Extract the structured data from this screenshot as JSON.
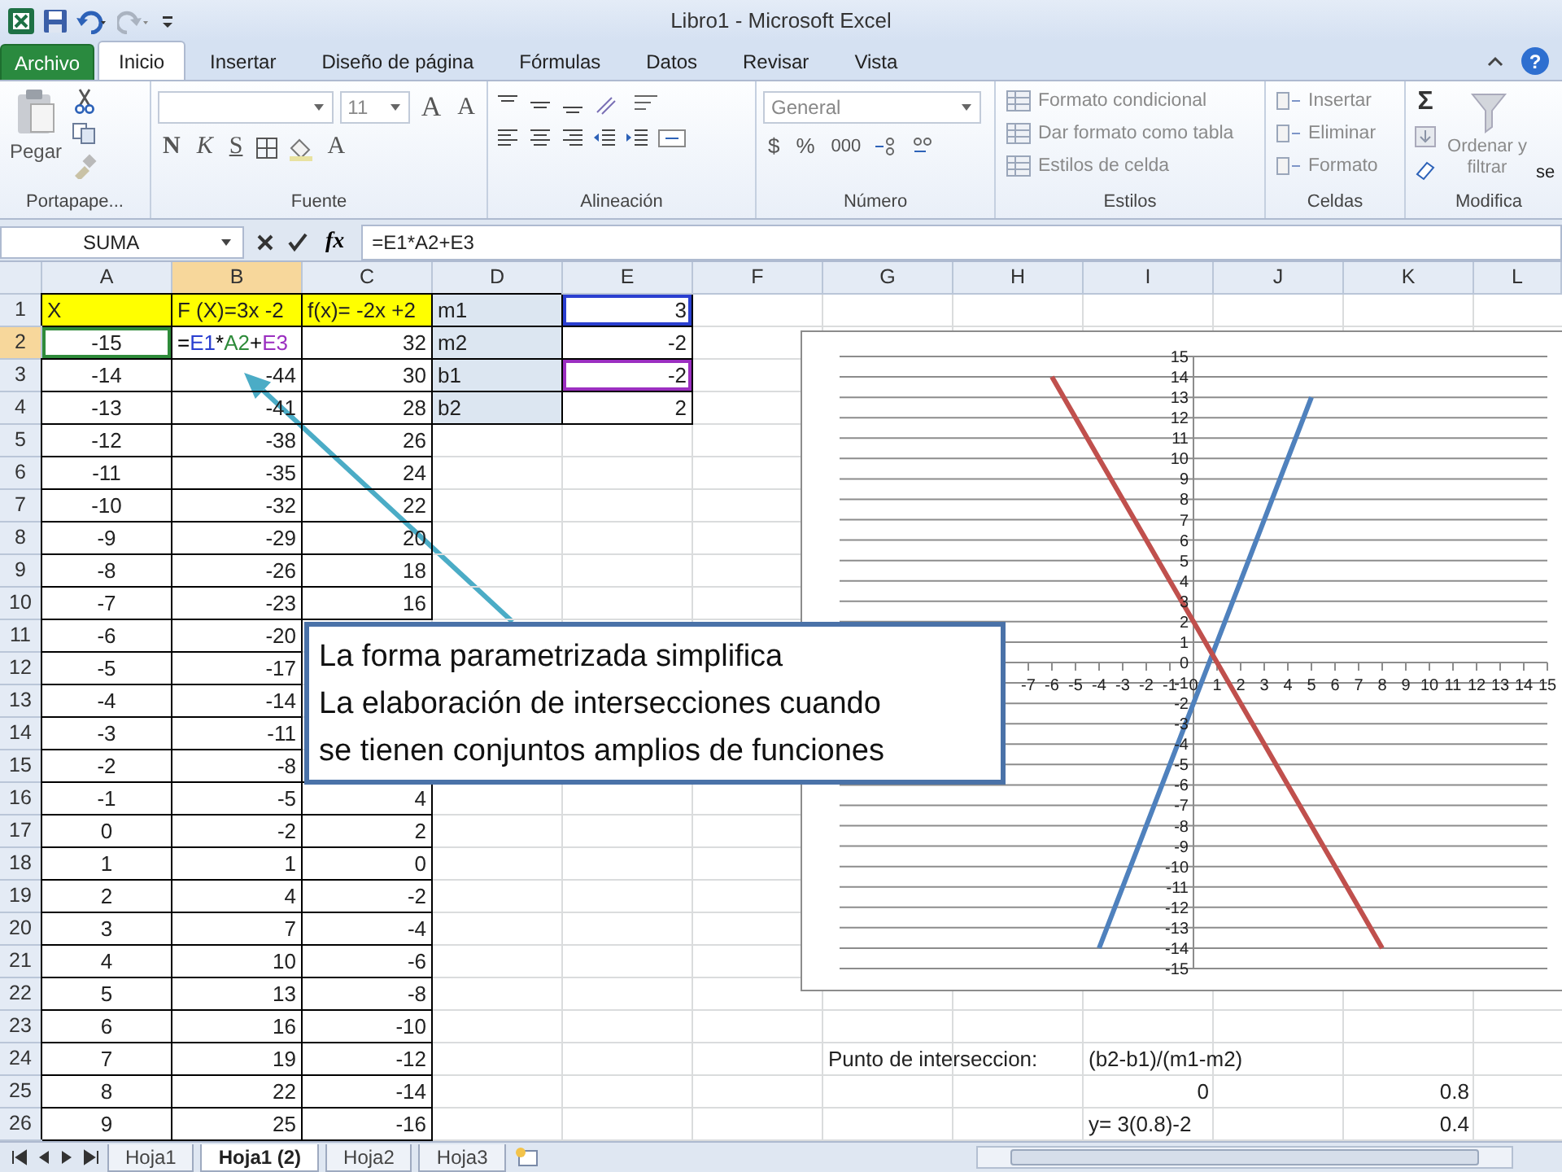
{
  "window": {
    "title": "Libro1  -  Microsoft Excel"
  },
  "ribbon_tabs": [
    {
      "label": "Archivo",
      "kind": "file",
      "selected": false
    },
    {
      "label": "Inicio",
      "kind": "tab",
      "selected": true
    },
    {
      "label": "Insertar",
      "kind": "tab",
      "selected": false
    },
    {
      "label": "Diseño de página",
      "kind": "tab",
      "selected": false
    },
    {
      "label": "Fórmulas",
      "kind": "tab",
      "selected": false
    },
    {
      "label": "Datos",
      "kind": "tab",
      "selected": false
    },
    {
      "label": "Revisar",
      "kind": "tab",
      "selected": false
    },
    {
      "label": "Vista",
      "kind": "tab",
      "selected": false
    }
  ],
  "help": {
    "label": "?"
  },
  "ribbon": {
    "clipboard": {
      "paste": "Pegar",
      "label": "Portapape..."
    },
    "font": {
      "font_size": "11",
      "grow": "A",
      "shrink": "A",
      "bold": "N",
      "italic": "K",
      "underline": "S",
      "font_color": "A",
      "label": "Fuente"
    },
    "alignment": {
      "label": "Alineación"
    },
    "number": {
      "format": "General",
      "currency": "$",
      "percent": "%",
      "thousands": "000",
      "label": "Número"
    },
    "styles": {
      "items": [
        {
          "label": "Formato condicional",
          "disabled": true
        },
        {
          "label": "Dar formato como tabla",
          "disabled": true
        },
        {
          "label": "Estilos de celda",
          "disabled": true
        }
      ],
      "label": "Estilos"
    },
    "cells": {
      "items": [
        {
          "label": "Insertar",
          "disabled": true
        },
        {
          "label": "Eliminar",
          "disabled": true
        },
        {
          "label": "Formato",
          "disabled": true
        }
      ],
      "label": "Celdas"
    },
    "editing": {
      "sum": "Σ",
      "sort": "Ordenar y filtrar",
      "cut_text": "se",
      "label": "Modifica"
    }
  },
  "formula_bar": {
    "name_box": "SUMA",
    "fx": "fx",
    "formula": "=E1*A2+E3"
  },
  "sheet": {
    "columns": [
      {
        "label": "A",
        "selected": false
      },
      {
        "label": "B",
        "selected": true
      },
      {
        "label": "C",
        "selected": false
      },
      {
        "label": "D",
        "selected": false
      },
      {
        "label": "E",
        "selected": false
      },
      {
        "label": "F",
        "selected": false
      },
      {
        "label": "G",
        "selected": false
      },
      {
        "label": "H",
        "selected": false
      },
      {
        "label": "I",
        "selected": false
      },
      {
        "label": "J",
        "selected": false
      },
      {
        "label": "K",
        "selected": false
      },
      {
        "label": "L",
        "selected": false
      }
    ],
    "rows": [
      {
        "number": "1",
        "selected": false,
        "cells": [
          {
            "value": "X",
            "kind": "header",
            "bordered": true
          },
          {
            "value": "F (X)=3x -2",
            "kind": "header",
            "bordered": true
          },
          {
            "value": "f(x)= -2x +2",
            "kind": "header",
            "bordered": true
          },
          {
            "value": "m1",
            "kind": "param",
            "bordered": true
          },
          {
            "value": "3",
            "kind": "number",
            "bordered": true,
            "color": "#2a3fd0"
          }
        ]
      },
      {
        "number": "2",
        "selected": true,
        "cells": [
          {
            "value": "-15",
            "kind": "centered",
            "bordered": true,
            "color": "#2e8b3a"
          },
          {
            "kind": "formula",
            "bordered": true,
            "tokens": [
              {
                "text": "=",
                "color": "#000000"
              },
              {
                "text": "E1",
                "color": "#2a3fd0"
              },
              {
                "text": "*",
                "color": "#000000"
              },
              {
                "text": "A2",
                "color": "#2e8b3a"
              },
              {
                "text": "+",
                "color": "#000000"
              },
              {
                "text": "E3",
                "color": "#9b2fc0"
              }
            ]
          },
          {
            "value": "32",
            "kind": "number",
            "bordered": true
          },
          {
            "value": "m2",
            "kind": "param",
            "bordered": true
          },
          {
            "value": "-2",
            "kind": "number",
            "bordered": true
          }
        ]
      },
      {
        "number": "3",
        "selected": false,
        "cells": [
          {
            "value": "-14",
            "kind": "centered",
            "bordered": true
          },
          {
            "value": "-44",
            "kind": "number",
            "bordered": true
          },
          {
            "value": "30",
            "kind": "number",
            "bordered": true
          },
          {
            "value": "b1",
            "kind": "param",
            "bordered": true
          },
          {
            "value": "-2",
            "kind": "number",
            "bordered": true,
            "color": "#9b2fc0"
          }
        ]
      },
      {
        "number": "4",
        "selected": false,
        "cells": [
          {
            "value": "-13",
            "kind": "centered",
            "bordered": true
          },
          {
            "value": "-41",
            "kind": "number",
            "bordered": true
          },
          {
            "value": "28",
            "kind": "number",
            "bordered": true
          },
          {
            "value": "b2",
            "kind": "param",
            "bordered": true
          },
          {
            "value": "2",
            "kind": "number",
            "bordered": true
          }
        ]
      },
      {
        "number": "5",
        "selected": false,
        "cells": [
          {
            "value": "-12",
            "kind": "centered",
            "bordered": true
          },
          {
            "value": "-38",
            "kind": "number",
            "bordered": true
          },
          {
            "value": "26",
            "kind": "number",
            "bordered": true
          }
        ]
      },
      {
        "number": "6",
        "selected": false,
        "cells": [
          {
            "value": "-11",
            "kind": "centered",
            "bordered": true
          },
          {
            "value": "-35",
            "kind": "number",
            "bordered": true
          },
          {
            "value": "24",
            "kind": "number",
            "bordered": true
          }
        ]
      },
      {
        "number": "7",
        "selected": false,
        "cells": [
          {
            "value": "-10",
            "kind": "centered",
            "bordered": true
          },
          {
            "value": "-32",
            "kind": "number",
            "bordered": true
          },
          {
            "value": "22",
            "kind": "number",
            "bordered": true
          }
        ]
      },
      {
        "number": "8",
        "selected": false,
        "cells": [
          {
            "value": "-9",
            "kind": "centered",
            "bordered": true
          },
          {
            "value": "-29",
            "kind": "number",
            "bordered": true
          },
          {
            "value": "20",
            "kind": "number",
            "bordered": true
          }
        ]
      },
      {
        "number": "9",
        "selected": false,
        "cells": [
          {
            "value": "-8",
            "kind": "centered",
            "bordered": true
          },
          {
            "value": "-26",
            "kind": "number",
            "bordered": true
          },
          {
            "value": "18",
            "kind": "number",
            "bordered": true
          }
        ]
      },
      {
        "number": "10",
        "selected": false,
        "cells": [
          {
            "value": "-7",
            "kind": "centered",
            "bordered": true
          },
          {
            "value": "-23",
            "kind": "number",
            "bordered": true
          },
          {
            "value": "16",
            "kind": "number",
            "bordered": true
          }
        ]
      },
      {
        "number": "11",
        "selected": false,
        "cells": [
          {
            "value": "-6",
            "kind": "centered",
            "bordered": true
          },
          {
            "value": "-20",
            "kind": "number",
            "bordered": true
          }
        ]
      },
      {
        "number": "12",
        "selected": false,
        "cells": [
          {
            "value": "-5",
            "kind": "centered",
            "bordered": true
          },
          {
            "value": "-17",
            "kind": "number",
            "bordered": true
          }
        ]
      },
      {
        "number": "13",
        "selected": false,
        "cells": [
          {
            "value": "-4",
            "kind": "centered",
            "bordered": true
          },
          {
            "value": "-14",
            "kind": "number",
            "bordered": true
          }
        ]
      },
      {
        "number": "14",
        "selected": false,
        "cells": [
          {
            "value": "-3",
            "kind": "centered",
            "bordered": true
          },
          {
            "value": "-11",
            "kind": "number",
            "bordered": true
          }
        ]
      },
      {
        "number": "15",
        "selected": false,
        "cells": [
          {
            "value": "-2",
            "kind": "centered",
            "bordered": true
          },
          {
            "value": "-8",
            "kind": "number",
            "bordered": true
          }
        ]
      },
      {
        "number": "16",
        "selected": false,
        "cells": [
          {
            "value": "-1",
            "kind": "centered",
            "bordered": true
          },
          {
            "value": "-5",
            "kind": "number",
            "bordered": true
          },
          {
            "value": "4",
            "kind": "number",
            "bordered": true
          }
        ]
      },
      {
        "number": "17",
        "selected": false,
        "cells": [
          {
            "value": "0",
            "kind": "centered",
            "bordered": true
          },
          {
            "value": "-2",
            "kind": "number",
            "bordered": true
          },
          {
            "value": "2",
            "kind": "number",
            "bordered": true
          }
        ]
      },
      {
        "number": "18",
        "selected": false,
        "cells": [
          {
            "value": "1",
            "kind": "centered",
            "bordered": true
          },
          {
            "value": "1",
            "kind": "number",
            "bordered": true
          },
          {
            "value": "0",
            "kind": "number",
            "bordered": true
          }
        ]
      },
      {
        "number": "19",
        "selected": false,
        "cells": [
          {
            "value": "2",
            "kind": "centered",
            "bordered": true
          },
          {
            "value": "4",
            "kind": "number",
            "bordered": true
          },
          {
            "value": "-2",
            "kind": "number",
            "bordered": true
          }
        ]
      },
      {
        "number": "20",
        "selected": false,
        "cells": [
          {
            "value": "3",
            "kind": "centered",
            "bordered": true
          },
          {
            "value": "7",
            "kind": "number",
            "bordered": true
          },
          {
            "value": "-4",
            "kind": "number",
            "bordered": true
          }
        ]
      },
      {
        "number": "21",
        "selected": false,
        "cells": [
          {
            "value": "4",
            "kind": "centered",
            "bordered": true
          },
          {
            "value": "10",
            "kind": "number",
            "bordered": true
          },
          {
            "value": "-6",
            "kind": "number",
            "bordered": true
          }
        ]
      },
      {
        "number": "22",
        "selected": false,
        "cells": [
          {
            "value": "5",
            "kind": "centered",
            "bordered": true
          },
          {
            "value": "13",
            "kind": "number",
            "bordered": true
          },
          {
            "value": "-8",
            "kind": "number",
            "bordered": true
          }
        ]
      },
      {
        "number": "23",
        "selected": false,
        "cells": [
          {
            "value": "6",
            "kind": "centered",
            "bordered": true
          },
          {
            "value": "16",
            "kind": "number",
            "bordered": true
          },
          {
            "value": "-10",
            "kind": "number",
            "bordered": true
          }
        ]
      },
      {
        "number": "24",
        "selected": false,
        "cells": [
          {
            "value": "7",
            "kind": "centered",
            "bordered": true
          },
          {
            "value": "19",
            "kind": "number",
            "bordered": true
          },
          {
            "value": "-12",
            "kind": "number",
            "bordered": true
          },
          null,
          null,
          null,
          {
            "value": "Punto de interseccion:",
            "kind": "text"
          },
          null,
          {
            "value": "(b2-b1)/(m1-m2)",
            "kind": "text"
          }
        ]
      },
      {
        "number": "25",
        "selected": false,
        "cells": [
          {
            "value": "8",
            "kind": "centered",
            "bordered": true
          },
          {
            "value": "22",
            "kind": "number",
            "bordered": true
          },
          {
            "value": "-14",
            "kind": "number",
            "bordered": true
          },
          null,
          null,
          null,
          null,
          null,
          {
            "value": "0",
            "kind": "number"
          },
          null,
          {
            "value": "0.8",
            "kind": "number"
          }
        ]
      },
      {
        "number": "26",
        "selected": false,
        "cells": [
          {
            "value": "9",
            "kind": "centered",
            "bordered": true
          },
          {
            "value": "25",
            "kind": "number",
            "bordered": true
          },
          {
            "value": "-16",
            "kind": "number",
            "bordered": true
          },
          null,
          null,
          null,
          null,
          null,
          {
            "value": "y= 3(0.8)-2",
            "kind": "text"
          },
          null,
          {
            "value": "0.4",
            "kind": "number"
          }
        ]
      }
    ],
    "chart": {
      "chart_data": {
        "type": "line",
        "x": [
          -6,
          -5,
          -4,
          -3,
          -2,
          -1,
          0,
          1,
          2,
          3,
          4,
          5,
          6,
          7,
          8
        ],
        "series": [
          {
            "color": "#4f81bd",
            "values": [
              null,
              null,
              -14,
              -11,
              -8,
              -5,
              -2,
              1,
              4,
              7,
              10,
              13,
              null,
              null,
              null
            ]
          },
          {
            "color": "#c0504d",
            "values": [
              14,
              12,
              10,
              8,
              6,
              4,
              2,
              0,
              -2,
              -4,
              -6,
              -8,
              -10,
              -12,
              -14
            ]
          }
        ],
        "grid": true,
        "xlim": [
          -15,
          15
        ],
        "ylim": [
          -15,
          15
        ],
        "xticks": [
          -7,
          -6,
          -5,
          -4,
          -3,
          -2,
          -1,
          0,
          1,
          2,
          3,
          4,
          5,
          6,
          7,
          8,
          9,
          10,
          11,
          12,
          13,
          14,
          15
        ],
        "yticks": [
          -15,
          -14,
          -13,
          -12,
          -11,
          -10,
          -9,
          -8,
          -7,
          -6,
          -5,
          -4,
          -3,
          -2,
          -1,
          0,
          1,
          2,
          3,
          4,
          5,
          6,
          7,
          8,
          9,
          10,
          11,
          12,
          13,
          14,
          15
        ]
      }
    },
    "callout": {
      "lines": [
        "La forma parametrizada simplifica",
        "La elaboración de intersecciones cuando",
        "se tienen conjuntos amplios de funciones"
      ]
    }
  },
  "sheet_tabs": [
    {
      "label": "Hoja1",
      "selected": false
    },
    {
      "label": "Hoja1 (2)",
      "selected": true
    },
    {
      "label": "Hoja2",
      "selected": false
    },
    {
      "label": "Hoja3",
      "selected": false
    }
  ]
}
